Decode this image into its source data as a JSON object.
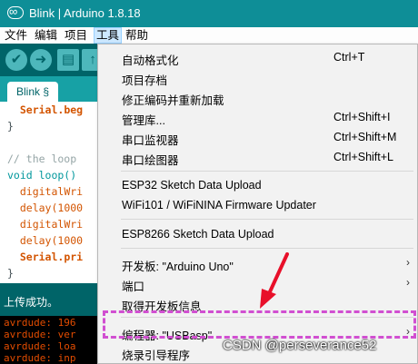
{
  "window": {
    "title": "Blink | Arduino 1.8.18"
  },
  "menubar": {
    "file": "文件",
    "edit": "编辑",
    "sketch": "项目",
    "tools": "工具",
    "help": "帮助"
  },
  "toolbar": {
    "verify": "✔",
    "upload": "➜",
    "new": "▤",
    "open": "↑",
    "serial": "⌕"
  },
  "tab": {
    "name": "Blink §",
    "dropdown": "▾"
  },
  "editor": {
    "lines": [
      {
        "indent": "  ",
        "text": "Serial.beg"
      },
      {
        "indent": "",
        "text": "}"
      },
      {
        "indent": "",
        "text": ""
      },
      {
        "indent": "",
        "text": "// the loop"
      },
      {
        "indent": "",
        "text": "void loop()"
      },
      {
        "indent": "  ",
        "text": "digitalWri"
      },
      {
        "indent": "  ",
        "text": "delay(1000"
      },
      {
        "indent": "  ",
        "text": "digitalWri"
      },
      {
        "indent": "  ",
        "text": "delay(1000"
      },
      {
        "indent": "  ",
        "text": "Serial.pri"
      },
      {
        "indent": "",
        "text": "}"
      }
    ]
  },
  "status": {
    "message": "上传成功。"
  },
  "console": {
    "lines": [
      "avrdude: 196",
      "avrdude: ver",
      "avrdude: loa",
      "avrdude: inp"
    ]
  },
  "tools_menu": {
    "items": [
      {
        "label": "自动格式化",
        "shortcut": "Ctrl+T"
      },
      {
        "label": "项目存档",
        "shortcut": ""
      },
      {
        "label": "修正编码并重新加载",
        "shortcut": ""
      },
      {
        "label": "管理库...",
        "shortcut": "Ctrl+Shift+I"
      },
      {
        "label": "串口监视器",
        "shortcut": "Ctrl+Shift+M"
      },
      {
        "label": "串口绘图器",
        "shortcut": "Ctrl+Shift+L"
      },
      {
        "label": "ESP32 Sketch Data Upload",
        "shortcut": ""
      },
      {
        "label": "WiFi101 / WiFiNINA Firmware Updater",
        "shortcut": ""
      },
      {
        "label": "ESP8266 Sketch Data Upload",
        "shortcut": ""
      },
      {
        "label": "开发板: \"Arduino Uno\"",
        "shortcut": ""
      },
      {
        "label": "端口",
        "shortcut": ""
      },
      {
        "label": "取得开发板信息",
        "shortcut": ""
      },
      {
        "label": "编程器: \"USBasp\"",
        "shortcut": ""
      },
      {
        "label": "烧录引导程序",
        "shortcut": ""
      }
    ],
    "submenu_arrow": "›"
  },
  "watermark": "CSDN @perseverance52",
  "colors": {
    "titlebar": "#0e8e97",
    "toolbar": "#006468",
    "highlight": "#d14fd1",
    "arrow": "#e8102a"
  }
}
